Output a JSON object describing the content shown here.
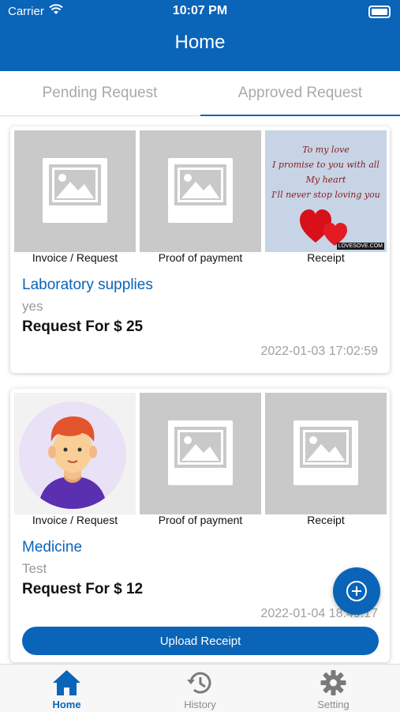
{
  "status_bar": {
    "carrier": "Carrier",
    "time": "10:07 PM"
  },
  "header": {
    "title": "Home"
  },
  "tabs": [
    {
      "label": "Pending Request"
    },
    {
      "label": "Approved Request"
    }
  ],
  "requests": [
    {
      "thumb_labels": [
        "Invoice / Request",
        "Proof of payment",
        "Receipt"
      ],
      "receipt_image_lines": [
        "To my love",
        "I promise to you with all",
        "My heart",
        "I'll never stop loving you"
      ],
      "receipt_image_brand": "LOVESOVE.COM",
      "title": "Laboratory supplies",
      "note": "yes",
      "amount": "Request For $ 25",
      "date": "2022-01-03 17:02:59"
    },
    {
      "thumb_labels": [
        "Invoice / Request",
        "Proof of payment",
        "Receipt"
      ],
      "title": "Medicine",
      "note": "Test",
      "amount": "Request For $ 12",
      "date": "2022-01-04 18:49:17",
      "upload_button": "Upload Receipt"
    }
  ],
  "bottom_nav": [
    {
      "label": "Home",
      "icon": "home-icon",
      "active": true
    },
    {
      "label": "History",
      "icon": "history-icon",
      "active": false
    },
    {
      "label": "Setting",
      "icon": "gear-icon",
      "active": false
    }
  ],
  "colors": {
    "primary": "#0a64b8",
    "placeholder_gray": "#c9c9c9",
    "avatar_bg": "#e9e1f5"
  }
}
